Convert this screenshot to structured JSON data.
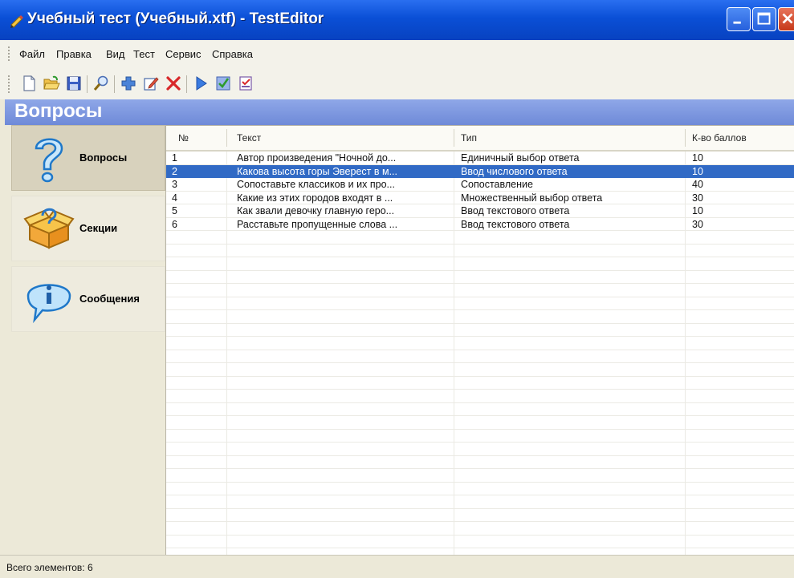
{
  "window": {
    "title": "Учебный тест (Учебный.xtf) - TestEditor"
  },
  "menu": [
    "Файл",
    "Правка",
    "Вид",
    "Тест",
    "Сервис",
    "Справка"
  ],
  "toolbar": {
    "icons": [
      "new-file-icon",
      "open-folder-icon",
      "save-icon",
      "search-icon",
      "add-icon",
      "edit-icon",
      "delete-icon",
      "play-icon",
      "check-icon",
      "report-icon"
    ]
  },
  "section": {
    "title": "Вопросы"
  },
  "nav": {
    "items": [
      {
        "label": "Вопросы",
        "icon": "question-icon",
        "active": true
      },
      {
        "label": "Секции",
        "icon": "sections-box-icon",
        "active": false
      },
      {
        "label": "Сообщения",
        "icon": "info-bubble-icon",
        "active": false
      }
    ]
  },
  "table": {
    "columns": [
      "№",
      "Текст",
      "Тип",
      "К-во баллов"
    ],
    "rows": [
      {
        "num": "1",
        "text": "Автор произведения \"Ночной до...",
        "type": "Единичный выбор ответа",
        "points": "10",
        "selected": false
      },
      {
        "num": "2",
        "text": "Какова высота горы Эверест в м...",
        "type": "Ввод числового ответа",
        "points": "10",
        "selected": true
      },
      {
        "num": "3",
        "text": "Сопоставьте классиков и их про...",
        "type": "Сопоставление",
        "points": "40",
        "selected": false
      },
      {
        "num": "4",
        "text": "Какие из этих городов входят в ...",
        "type": "Множественный выбор ответа",
        "points": "30",
        "selected": false
      },
      {
        "num": "5",
        "text": "Как звали девочку главную геро...",
        "type": "Ввод текстового ответа",
        "points": "10",
        "selected": false
      },
      {
        "num": "6",
        "text": "Расставьте пропущенные слова ...",
        "type": "Ввод текстового ответа",
        "points": "30",
        "selected": false
      }
    ]
  },
  "status": {
    "text": "Всего элементов: 6"
  },
  "colors": {
    "titlebar": "#0a4fd6",
    "selection": "#316ac5",
    "section_header": "#7b95de"
  }
}
